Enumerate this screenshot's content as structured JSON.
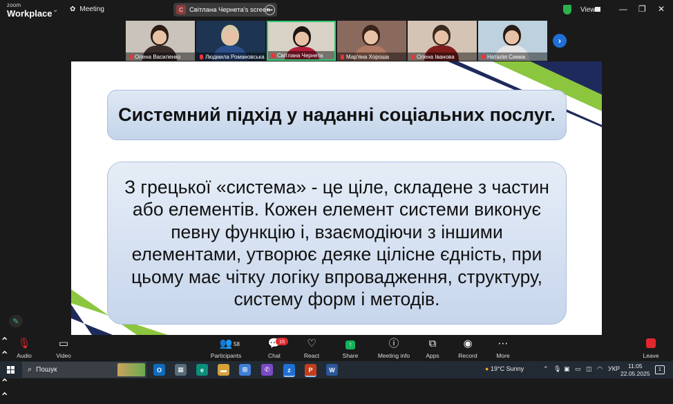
{
  "app": {
    "logo_line1": "zoom",
    "logo_line2": "Workplace",
    "meeting_label": "Meeting",
    "screen_share_badge": "С",
    "screen_share_label": "Світлана Чернета's screen",
    "view_label": "View"
  },
  "participants": [
    {
      "name": "Олена Василенко",
      "bg": "#c9c3bb",
      "hair": "#2b1d16",
      "shirt": "#3a2c2a"
    },
    {
      "name": "Людмила Романовська",
      "bg": "#1d3552",
      "hair": "#d7c9a8",
      "shirt": "#2c4f8c"
    },
    {
      "name": "Світлана Чернета",
      "bg": "#d8d2c7",
      "hair": "#1f1512",
      "shirt": "#b31e3a",
      "active": true
    },
    {
      "name": "Мар'яна Хороша",
      "bg": "#8b6a5e",
      "hair": "#3a221a",
      "shirt": "#b07a64"
    },
    {
      "name": "Олена Іванова",
      "bg": "#d3c4b5",
      "hair": "#3b2a20",
      "shirt": "#7f1d1d"
    },
    {
      "name": "Наталія Синюк",
      "bg": "#bdd1df",
      "hair": "#2a1d16",
      "shirt": "#e6e6e6"
    }
  ],
  "slide": {
    "title": "Системний підхід у наданні соціальних послуг.",
    "body": "З грецької «система» - це ціле, складене з частин або елементів. Кожен елемент системи виконує певну функцію і, взаємодіючи з іншими елементами, утворює деяке цілісне єдність, при цьому має чітку логіку впровадження, структуру, систему форм і методів."
  },
  "toolbar": {
    "audio": "Audio",
    "video": "Video",
    "participants": "Participants",
    "participants_count": "58",
    "chat": "Chat",
    "chat_badge": "15",
    "react": "React",
    "share": "Share",
    "meeting_info": "Meeting info",
    "apps": "Apps",
    "record": "Record",
    "more": "More",
    "leave": "Leave"
  },
  "taskbar": {
    "search_placeholder": "Пошук",
    "weather": "19°C  Sunny",
    "language": "УКР",
    "time": "11:05",
    "date": "22.05.2025",
    "notifications_count": "1"
  },
  "colors": {
    "zoom_blue": "#1f6fd6",
    "share_green": "#13b35a",
    "leave_red": "#e0282e",
    "slide_navy": "#1f2a5c",
    "slide_green": "#8cc63f",
    "active_tile_border": "#2ecc71"
  }
}
